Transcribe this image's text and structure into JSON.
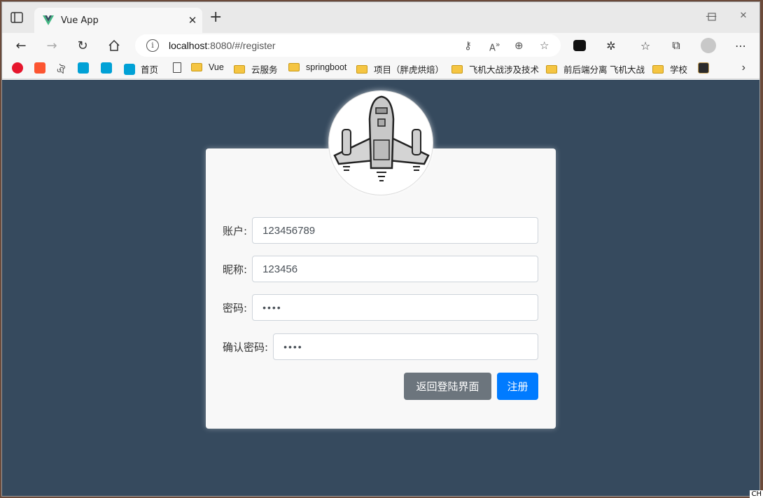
{
  "browser": {
    "tab_title": "Vue App",
    "url_host": "localhost",
    "url_rest": ":8080/#/register",
    "bookmarks": [
      {
        "label": "首页",
        "icon": "bilibili-icon"
      },
      {
        "label": "",
        "icon": "page-icon"
      },
      {
        "label": "Vue",
        "icon": "folder-icon"
      },
      {
        "label": "云服务",
        "icon": "folder-icon"
      },
      {
        "label": "springboot",
        "icon": "folder-icon"
      },
      {
        "label": "项目（胖虎烘焙）",
        "icon": "folder-icon"
      },
      {
        "label": "飞机大战涉及技术",
        "icon": "folder-icon"
      },
      {
        "label": "前后端分离 飞机大战",
        "icon": "folder-icon"
      },
      {
        "label": "学校",
        "icon": "folder-icon"
      }
    ],
    "colors": {
      "tab_bg": "#e9e9e9",
      "toolbar_bg": "#f7f7f7",
      "folder": "#f5c542"
    }
  },
  "form": {
    "account_label": "账户:",
    "account_value": "123456789",
    "nickname_label": "昵称:",
    "nickname_value": "123456",
    "password_label": "密码:",
    "password_value": "••••",
    "confirm_label": "确认密码:",
    "confirm_value": "••••",
    "back_button": "返回登陆界面",
    "register_button": "注册"
  },
  "page": {
    "colors": {
      "background": "#364a5e",
      "card": "#f8f8f8",
      "primary": "#007bff",
      "secondary": "#6c757d"
    },
    "corner_text": "CH"
  }
}
